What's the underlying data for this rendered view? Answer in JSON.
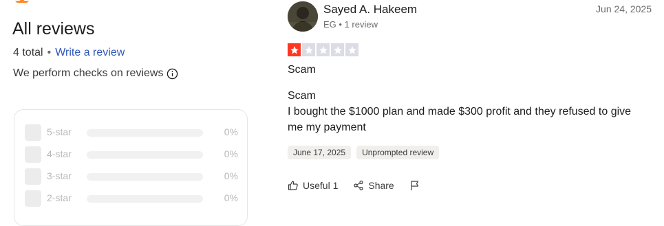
{
  "summary": {
    "title": "All reviews",
    "total": "4 total",
    "separator": "•",
    "write_review": "Write a review",
    "checks_text": "We perform checks on reviews"
  },
  "distribution": [
    {
      "label": "5-star",
      "percent": "0%"
    },
    {
      "label": "4-star",
      "percent": "0%"
    },
    {
      "label": "3-star",
      "percent": "0%"
    },
    {
      "label": "2-star",
      "percent": "0%"
    }
  ],
  "review": {
    "reviewer_name": "Sayed A. Hakeem",
    "reviewer_meta": "EG • 1 review",
    "date": "Jun 24, 2025",
    "rating": 1,
    "rating_max": 5,
    "title": "Scam",
    "body_lines": [
      "Scam",
      "I bought the $1000 plan and made $300 profit and they refused to give",
      "me my payment"
    ],
    "tags": [
      "June 17, 2025",
      "Unprompted review"
    ],
    "actions": {
      "useful": "Useful 1",
      "share": "Share"
    }
  },
  "colors": {
    "star_filled": "#ff3722",
    "star_empty": "#dcdce6",
    "link": "#3057b5",
    "accent_orange": "#ff8622"
  },
  "icons": [
    "info-icon",
    "thumbs-up-icon",
    "share-icon",
    "flag-icon",
    "star-icon"
  ]
}
